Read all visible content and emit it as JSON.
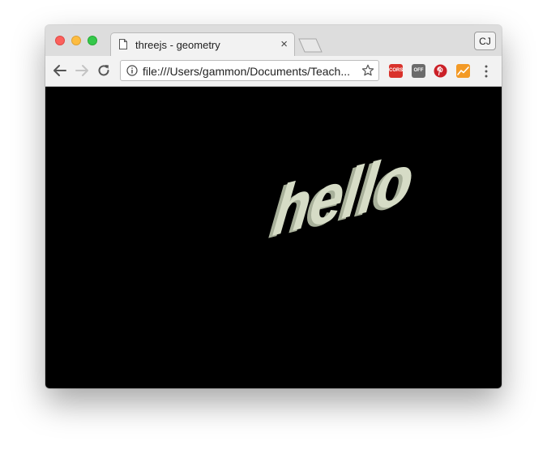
{
  "window": {
    "tab": {
      "title": "threejs - geometry",
      "close_glyph": "×"
    },
    "profile": {
      "initials": "CJ"
    }
  },
  "toolbar": {
    "url": "file:///Users/gammon/Documents/Teach...",
    "extensions": {
      "cors": {
        "label": "CORS",
        "color": "#d9322b"
      },
      "off": {
        "label": "OFF",
        "color": "#6b6b6b"
      },
      "pinterest": {
        "color": "#cb2027"
      },
      "chart": {
        "color": "#f39a26"
      }
    }
  },
  "scene": {
    "text": "hello",
    "background": "#000000",
    "text_color": "#d6dcc6",
    "side_color": "#a8b09a"
  },
  "colors": {
    "traffic_close": "#fc605c",
    "traffic_minimize": "#fdbc40",
    "traffic_maximize": "#34c84a"
  }
}
